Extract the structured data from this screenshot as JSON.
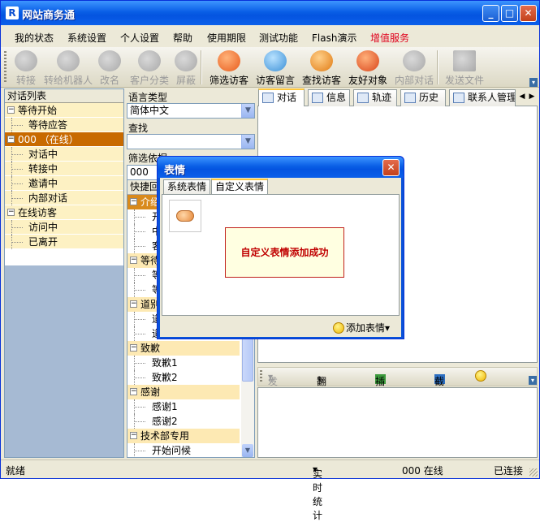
{
  "window": {
    "title": "网站商务通"
  },
  "menu": [
    "我的状态",
    "系统设置",
    "个人设置",
    "帮助",
    "使用期限",
    "测试功能",
    "Flash演示",
    "增值服务"
  ],
  "toolbar": [
    {
      "label": "转接",
      "enabled": false
    },
    {
      "label": "转给机器人",
      "enabled": false
    },
    {
      "label": "改名",
      "enabled": false
    },
    {
      "label": "客户分类",
      "enabled": false
    },
    {
      "label": "屏蔽",
      "enabled": false
    },
    {
      "label": "筛选访客",
      "enabled": true
    },
    {
      "label": "访客留言",
      "enabled": true
    },
    {
      "label": "查找访客",
      "enabled": true
    },
    {
      "label": "友好对象",
      "enabled": true
    },
    {
      "label": "内部对话",
      "enabled": false
    },
    {
      "label": "发送文件",
      "enabled": false
    }
  ],
  "left": {
    "header": "对话列表",
    "groups": [
      {
        "label": "等待开始",
        "selected": false,
        "items": [
          "等待应答"
        ]
      },
      {
        "label": "000 （在线）",
        "selected": true,
        "items": [
          "对话中",
          "转接中",
          "邀请中",
          "内部对话"
        ]
      },
      {
        "label": "在线访客",
        "selected": false,
        "items": [
          "访问中",
          "已离开"
        ]
      }
    ]
  },
  "middle": {
    "lang_label": "语言类型",
    "lang_value": "简体中文",
    "find_label": "查找",
    "find_value": "",
    "filter_label": "筛选依据",
    "filter_value": "000",
    "kb_header": "快捷回复",
    "kb_groups": [
      {
        "label": "介绍",
        "selected": true,
        "items": [
          "开",
          "中",
          "客"
        ]
      },
      {
        "label": "等待",
        "selected": false,
        "items": [
          "等",
          "等"
        ]
      },
      {
        "label": "道别",
        "selected": false,
        "items": [
          "道",
          "道"
        ]
      },
      {
        "label": "致歉",
        "selected": false,
        "items": [
          "致歉1",
          "致歉2"
        ]
      },
      {
        "label": "感谢",
        "selected": false,
        "items": [
          "感谢1",
          "感谢2"
        ]
      },
      {
        "label": "技术部专用",
        "selected": false,
        "items": [
          "开始问候"
        ]
      }
    ]
  },
  "right": {
    "tabs": [
      "对话",
      "信息",
      "轨迹",
      "历史",
      "联系人管理"
    ],
    "send_bar": {
      "send": "发送",
      "translate": "翻译助手",
      "insert_image": "插入图片",
      "screenshot": "截图"
    }
  },
  "dialog": {
    "title": "表情",
    "tabs": [
      "系统表情",
      "自定义表情"
    ],
    "active_tab": 1,
    "toast": "自定义表情添加成功",
    "add_button": "添加表情"
  },
  "status": {
    "left": "就绪",
    "stats": "实时统计",
    "user": "000 在线",
    "conn": "已连接"
  }
}
